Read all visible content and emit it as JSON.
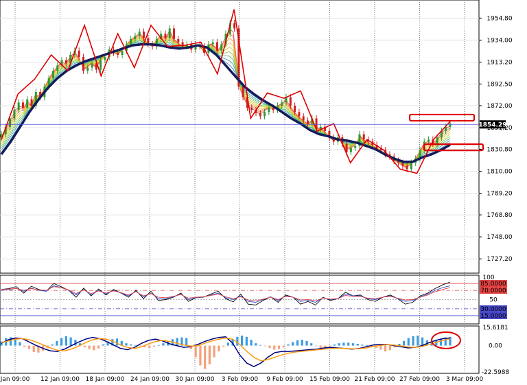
{
  "chart_data": [
    {
      "type": "line",
      "panel": "price",
      "ylim": [
        1715,
        1968
      ],
      "y_ticks": [
        "1954.80",
        "1934.00",
        "1913.20",
        "1892.50",
        "1872.00",
        "1851.20",
        "1830.80",
        "1810.00",
        "1789.20",
        "1768.80",
        "1748.00",
        "1727.20"
      ],
      "last_price_label": "1854.29",
      "last_price": 1854.29,
      "grid": "vertical-dotted",
      "zigzag": [
        1840,
        1883,
        1897,
        1920,
        1905,
        1948,
        1900,
        1940,
        1908,
        1948,
        1928,
        1929,
        1932,
        1902,
        1963,
        1860,
        1884,
        1879,
        1886,
        1848,
        1855,
        1818,
        1840,
        1830,
        1812,
        1808,
        1840,
        1857
      ],
      "candles": [
        1845,
        1852,
        1860,
        1868,
        1875,
        1870,
        1878,
        1872,
        1885,
        1880,
        1890,
        1898,
        1905,
        1910,
        1915,
        1912,
        1920,
        1924,
        1918,
        1905,
        1908,
        1912,
        1906,
        1915,
        1918,
        1925,
        1922,
        1920,
        1924,
        1930,
        1935,
        1938,
        1942,
        1936,
        1930,
        1928,
        1935,
        1940,
        1936,
        1945,
        1935,
        1932,
        1928,
        1930,
        1925,
        1930,
        1928,
        1922,
        1930,
        1932,
        1924,
        1930,
        1940,
        1950,
        1945,
        1890,
        1880,
        1870,
        1868,
        1865,
        1862,
        1866,
        1870,
        1868,
        1872,
        1875,
        1880,
        1872,
        1866,
        1862,
        1858,
        1855,
        1860,
        1850,
        1852,
        1848,
        1842,
        1838,
        1842,
        1836,
        1828,
        1832,
        1834,
        1845,
        1840,
        1838,
        1835,
        1832,
        1830,
        1826,
        1824,
        1820,
        1818,
        1815,
        1812,
        1818,
        1822,
        1830,
        1838,
        1840,
        1836,
        1842,
        1848,
        1852,
        1855
      ],
      "slow_ma": [
        1826,
        1838,
        1852,
        1866,
        1878,
        1889,
        1898,
        1905,
        1910,
        1914,
        1917,
        1920,
        1923,
        1926,
        1929,
        1930,
        1930,
        1929,
        1927,
        1926,
        1927,
        1929,
        1927,
        1920,
        1910,
        1900,
        1890,
        1883,
        1877,
        1872,
        1866,
        1860,
        1855,
        1849,
        1845,
        1843,
        1840,
        1839,
        1837,
        1834,
        1831,
        1826,
        1822,
        1819,
        1819,
        1823,
        1826,
        1830,
        1835
      ],
      "resistance_box": {
        "price": 1861
      },
      "support_box": {
        "price": 1833
      }
    },
    {
      "type": "line",
      "panel": "oscillator",
      "ylim": [
        0,
        100
      ],
      "levels": [
        {
          "label": "85.0000",
          "value": 85,
          "color": "#e34040"
        },
        {
          "label": "70.0000",
          "value": 70,
          "color": "#e34040"
        },
        {
          "label": "50",
          "value": 50,
          "color": "#9a9a9a"
        },
        {
          "label": "30.0000",
          "value": 30,
          "color": "#4646c8"
        },
        {
          "label": "15.0000",
          "value": 15,
          "color": "#4646c8"
        }
      ],
      "top_label": "100",
      "series": [
        {
          "color": "#000000",
          "values": [
            72,
            74,
            78,
            64,
            79,
            72,
            68,
            85,
            78,
            70,
            55,
            75,
            58,
            73,
            60,
            72,
            64,
            55,
            70,
            52,
            68,
            48,
            50,
            55,
            64,
            46,
            54,
            55,
            62,
            68,
            52,
            45,
            62,
            40,
            38,
            48,
            56,
            44,
            60,
            55,
            40,
            46,
            38,
            55,
            48,
            52,
            66,
            58,
            60,
            50,
            46,
            55,
            60,
            52,
            40,
            44,
            58,
            64,
            74,
            82,
            88
          ]
        },
        {
          "color": "#2a4de0",
          "values": [
            70,
            72,
            74,
            68,
            75,
            70,
            68,
            80,
            76,
            70,
            60,
            72,
            60,
            70,
            62,
            70,
            64,
            58,
            68,
            56,
            64,
            52,
            52,
            56,
            62,
            50,
            54,
            56,
            60,
            64,
            54,
            50,
            58,
            46,
            44,
            50,
            56,
            48,
            58,
            55,
            46,
            48,
            44,
            54,
            50,
            52,
            62,
            58,
            58,
            52,
            50,
            55,
            58,
            52,
            46,
            48,
            56,
            62,
            70,
            76,
            80
          ]
        },
        {
          "color": "#e34040",
          "values": [
            72,
            73,
            74,
            70,
            74,
            71,
            70,
            78,
            76,
            71,
            63,
            71,
            63,
            69,
            64,
            69,
            65,
            60,
            67,
            58,
            63,
            55,
            54,
            57,
            61,
            53,
            55,
            56,
            59,
            62,
            56,
            52,
            56,
            49,
            47,
            51,
            55,
            50,
            57,
            55,
            49,
            50,
            47,
            53,
            51,
            52,
            59,
            57,
            57,
            53,
            52,
            55,
            57,
            53,
            49,
            50,
            55,
            60,
            67,
            72,
            76
          ]
        }
      ]
    },
    {
      "type": "bar",
      "panel": "macd",
      "ylim": [
        -22.5988,
        15.6181
      ],
      "y_ticks": [
        "15.6181",
        "0.00",
        "-22.5988"
      ],
      "histogram": [
        3.5,
        6.5,
        7.2,
        6.0,
        3.0,
        -1.0,
        -3.0,
        -5.5,
        -6.0,
        -4.5,
        -2.0,
        1.0,
        4.0,
        6.5,
        8.0,
        7.0,
        5.0,
        2.0,
        -1.5,
        -3.0,
        -4.0,
        -2.5,
        1.0,
        3.5,
        5.5,
        6.0,
        4.0,
        2.0,
        1.0,
        0.5,
        -0.5,
        -1.5,
        -2.0,
        -1.0,
        0.5,
        2.0,
        3.5,
        5.5,
        6.5,
        7.0,
        6.5,
        -3.0,
        -10.0,
        -17.0,
        -20.0,
        -16.0,
        -10.0,
        -5.0,
        -1.0,
        2.5,
        5.5,
        7.5,
        8.5,
        7.5,
        5.0,
        2.0,
        0.5,
        -0.5,
        -2.0,
        -3.5,
        -3.0,
        -1.5,
        1.0,
        3.0,
        4.5,
        5.0,
        4.0,
        2.0,
        -0.5,
        -2.0,
        -1.5,
        -0.5,
        1.0,
        2.0,
        2.5,
        2.5,
        2.0,
        1.5,
        0.8,
        0.2,
        -0.8,
        -2.0,
        -3.5,
        -5.0,
        -4.0,
        -1.5,
        1.5,
        4.0,
        6.5,
        8.0,
        8.5,
        7.0,
        4.5,
        3.0,
        4.5,
        6.0,
        7.0,
        7.5
      ],
      "series": [
        {
          "color": "#000080",
          "values": [
            2,
            5,
            6.5,
            6,
            3,
            0,
            -2.5,
            -4.5,
            -5,
            -3,
            0,
            3,
            5.5,
            7,
            6,
            3.5,
            0.5,
            -2.5,
            -3.5,
            -1.5,
            2,
            4.5,
            5.5,
            4,
            1.5,
            0,
            -1.5,
            -1,
            1,
            3.5,
            5.5,
            7,
            7.5,
            2,
            -8,
            -15,
            -18,
            -15,
            -10,
            -6,
            -5,
            -5,
            -4.5,
            -4,
            -3.5,
            -3,
            -2,
            -1.5,
            -2,
            -2.5,
            -3,
            -2.5,
            -1,
            0.5,
            1,
            1,
            0,
            -1,
            -2,
            -1.5,
            0,
            2.5,
            4.5,
            6,
            6.5
          ]
        },
        {
          "color": "#ff9a10",
          "values": [
            2.5,
            4,
            5.5,
            6,
            5,
            3,
            0.5,
            -2,
            -4,
            -4.5,
            -3,
            -0.5,
            2.5,
            5,
            6,
            5.5,
            3.5,
            0.5,
            -1.5,
            -2.5,
            -1,
            1.5,
            3.5,
            4.5,
            3.5,
            2,
            0.5,
            -0.5,
            0,
            2,
            4,
            5.5,
            6.5,
            5.5,
            1,
            -5,
            -10,
            -13,
            -12,
            -10,
            -8,
            -6.5,
            -5.5,
            -4.8,
            -4.2,
            -3.6,
            -3,
            -2.5,
            -2.3,
            -2.5,
            -2.8,
            -2.8,
            -2,
            -0.8,
            0.2,
            0.8,
            0.5,
            -0.3,
            -1.2,
            -1.5,
            -0.8,
            0.8,
            2.8,
            4.5,
            5.8
          ]
        }
      ]
    }
  ],
  "x_axis": {
    "labels": [
      "Jan 09:00",
      "12 Jan 09:00",
      "18 Jan 09:00",
      "24 Jan 09:00",
      "30 Jan 09:00",
      "3 Feb 09:00",
      "9 Feb 09:00",
      "15 Feb 09:00",
      "21 Feb 09:00",
      "27 Feb 09:00",
      "3 Mar 09:00"
    ]
  },
  "colors": {
    "background": "#ffffff",
    "bull_candle": "#2e9a2e",
    "bear_candle": "#d02020",
    "zigzag": "#e00000",
    "slow_ma": "#141c5a",
    "price_line": "#4a4ae0",
    "price_badge": "#000000",
    "macd_pos": "#3c9be0",
    "macd_neg": "#f5a07a",
    "marker": "#e00000"
  }
}
